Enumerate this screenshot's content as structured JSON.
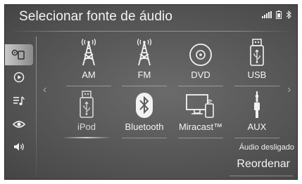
{
  "header": {
    "title": "Selecionar fonte de áudio",
    "status_icons": [
      "signal-bars-icon",
      "phone-battery-icon",
      "bluetooth-icon"
    ]
  },
  "sidebar": {
    "items": [
      {
        "icon": "media-source-icon",
        "active": true
      },
      {
        "icon": "play-icon",
        "active": false
      },
      {
        "icon": "playlist-icon",
        "active": false
      },
      {
        "icon": "view-icon",
        "active": false
      },
      {
        "icon": "volume-icon",
        "active": false
      }
    ]
  },
  "sources": [
    {
      "label": "AM",
      "icon": "radio-tower-icon"
    },
    {
      "label": "FM",
      "icon": "radio-tower-icon"
    },
    {
      "label": "DVD",
      "icon": "disc-icon"
    },
    {
      "label": "USB",
      "icon": "usb-icon"
    },
    {
      "label": "iPod",
      "icon": "ipod-usb-icon",
      "selected": true
    },
    {
      "label": "Bluetooth",
      "icon": "bluetooth-icon"
    },
    {
      "label": "Miracast™",
      "icon": "miracast-icon"
    },
    {
      "label": "AUX",
      "icon": "aux-jack-icon"
    }
  ],
  "footer": {
    "audio_status": "Áudio desligado",
    "reorder_label": "Reordenar"
  }
}
